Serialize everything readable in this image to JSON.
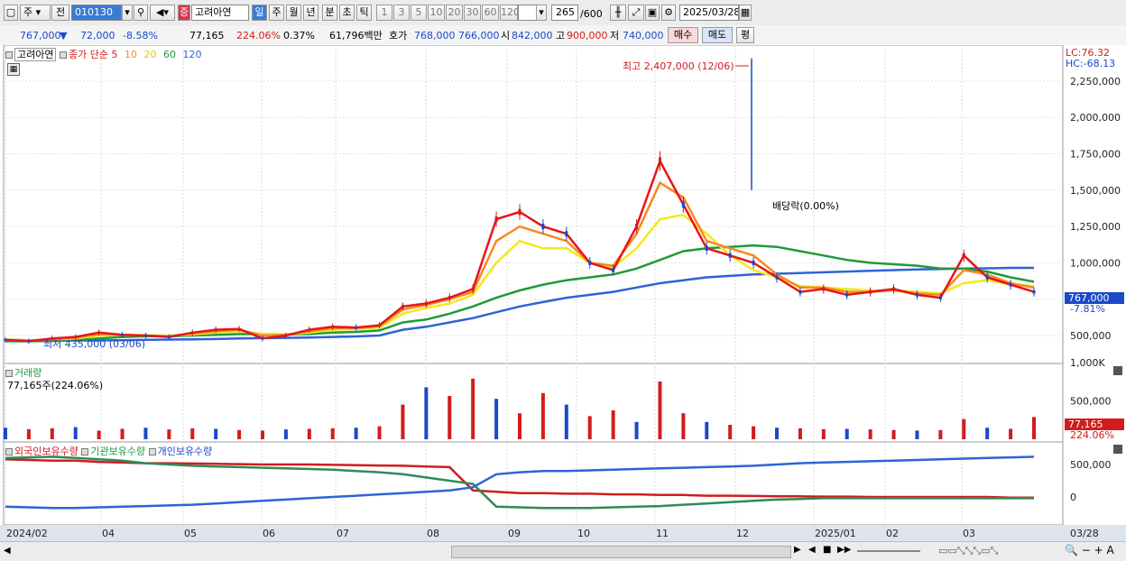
{
  "toolbar": {
    "market_label": "주",
    "prev_label": "전",
    "code": "010130",
    "stock_badge": "증",
    "stock_name": "고려아연",
    "period_tabs": [
      "일",
      "주",
      "월",
      "년",
      "분",
      "초",
      "틱"
    ],
    "active_period": "일",
    "intervals": [
      "1",
      "3",
      "5",
      "10",
      "20",
      "30",
      "60",
      "120"
    ],
    "count": "265",
    "count_total": "/600",
    "date": "2025/03/28"
  },
  "quote": {
    "price": "767,000",
    "change_arrow": "▼",
    "change": "72,000",
    "change_pct": "-8.58%",
    "volume": "77,165",
    "volume_ratio": "224.06%",
    "turnover": "0.37%",
    "amount": "61,796백만",
    "ask_label": "호가",
    "ask": "768,000",
    "bid": "766,000",
    "open_label": "시",
    "open": "842,000",
    "high_label": "고",
    "high": "900,000",
    "low_label": "저",
    "low": "740,000",
    "buy_label": "매수",
    "sell_label": "매도",
    "eval_label": "평"
  },
  "price_panel": {
    "legend_name": "고려아연",
    "ma_label": "종가 단순",
    "ma_periods": [
      "5",
      "10",
      "20",
      "60",
      "120"
    ],
    "ma_colors": [
      "#e8141b",
      "#f58a1f",
      "#f5e81b",
      "#1f9a3a",
      "#2e63d6"
    ],
    "lc": "LC:76.32",
    "hc": "HC:-68.13",
    "high_annotation": "최고 2,407,000 (12/06)",
    "low_annotation": "최저 435,000 (03/06)",
    "dividend_annotation": "배당락(0.00%)",
    "current_price_tag": "767,000",
    "current_pct_tag": "-7.81%"
  },
  "volume_panel": {
    "title": "거래량",
    "subtitle": "77,165주(224.06%)",
    "current_tag": "77,165",
    "current_pct_tag": "224.06%"
  },
  "holdings_panel": {
    "legend": [
      "외국인보유수량",
      "기관보유수량",
      "개인보유수량"
    ]
  },
  "x_axis": {
    "labels": [
      "2024/02",
      "04",
      "05",
      "06",
      "07",
      "08",
      "09",
      "10",
      "11",
      "12",
      "2025/01",
      "02",
      "03"
    ],
    "last_label": "03/28"
  },
  "chart_data": {
    "type": "line",
    "price_y_ticks": [
      "2,250,000",
      "2,000,000",
      "1,750,000",
      "1,500,000",
      "1,250,000",
      "1,000,000",
      "750,000",
      "500,000"
    ],
    "volume_y_ticks": [
      "1,000K",
      "500,000"
    ],
    "holdings_y_ticks": [
      "500,000",
      "0"
    ],
    "x_months": [
      "2024/02",
      "04",
      "05",
      "06",
      "07",
      "08",
      "09",
      "10",
      "11",
      "12",
      "2025/01",
      "02",
      "03"
    ],
    "ma5": [
      470,
      460,
      480,
      490,
      520,
      505,
      500,
      490,
      520,
      540,
      545,
      480,
      500,
      540,
      560,
      555,
      570,
      700,
      720,
      760,
      820,
      1300,
      1350,
      1250,
      1200,
      1000,
      950,
      1250,
      1700,
      1400,
      1100,
      1050,
      1000,
      900,
      800,
      820,
      780,
      800,
      820,
      780,
      760,
      1050,
      900,
      850,
      800
    ],
    "ma10": [
      470,
      465,
      475,
      485,
      510,
      505,
      500,
      495,
      515,
      530,
      540,
      500,
      505,
      530,
      550,
      550,
      565,
      680,
      710,
      750,
      800,
      1150,
      1250,
      1200,
      1150,
      1000,
      980,
      1200,
      1550,
      1450,
      1150,
      1100,
      1050,
      920,
      830,
      830,
      800,
      800,
      810,
      790,
      780,
      950,
      920,
      860,
      830
    ],
    "ma20": [
      470,
      468,
      472,
      480,
      500,
      505,
      502,
      498,
      508,
      520,
      530,
      510,
      508,
      520,
      540,
      545,
      555,
      650,
      690,
      720,
      780,
      1000,
      1150,
      1100,
      1100,
      1000,
      970,
      1100,
      1300,
      1330,
      1200,
      1050,
      950,
      900,
      840,
      830,
      820,
      810,
      810,
      800,
      790,
      860,
      880,
      850,
      840
    ],
    "ma60": [
      460,
      460,
      462,
      468,
      480,
      490,
      495,
      495,
      500,
      505,
      510,
      510,
      508,
      510,
      520,
      525,
      535,
      590,
      610,
      650,
      700,
      760,
      810,
      850,
      880,
      900,
      920,
      960,
      1020,
      1080,
      1100,
      1110,
      1120,
      1110,
      1080,
      1050,
      1020,
      1000,
      990,
      980,
      960,
      960,
      940,
      900,
      870
    ],
    "ma120": [
      470,
      468,
      466,
      465,
      466,
      468,
      470,
      472,
      474,
      476,
      480,
      482,
      484,
      486,
      490,
      494,
      500,
      540,
      560,
      590,
      620,
      660,
      700,
      730,
      760,
      780,
      800,
      830,
      860,
      880,
      900,
      910,
      920,
      925,
      930,
      935,
      940,
      945,
      950,
      955,
      958,
      960,
      962,
      965,
      965
    ],
    "volume": [
      40,
      35,
      38,
      42,
      30,
      36,
      40,
      34,
      38,
      36,
      32,
      30,
      34,
      36,
      38,
      40,
      45,
      120,
      180,
      150,
      210,
      140,
      90,
      160,
      120,
      80,
      100,
      60,
      200,
      90,
      60,
      50,
      45,
      40,
      38,
      35,
      36,
      34,
      32,
      30,
      32,
      70,
      40,
      36,
      77
    ],
    "foreign_holdings": [
      580,
      570,
      560,
      560,
      540,
      530,
      520,
      520,
      515,
      510,
      505,
      500,
      500,
      500,
      495,
      490,
      485,
      480,
      470,
      460,
      100,
      80,
      60,
      60,
      50,
      50,
      40,
      40,
      30,
      30,
      20,
      20,
      15,
      10,
      10,
      5,
      5,
      0,
      0,
      0,
      0,
      0,
      0,
      -10,
      -10
    ],
    "institution_holdings": [
      600,
      610,
      620,
      600,
      580,
      560,
      520,
      500,
      480,
      470,
      460,
      450,
      440,
      430,
      420,
      400,
      380,
      350,
      300,
      250,
      200,
      -150,
      -160,
      -170,
      -170,
      -170,
      -160,
      -150,
      -140,
      -120,
      -100,
      -80,
      -60,
      -40,
      -30,
      -20,
      -20,
      -20,
      -20,
      -20,
      -20,
      -20,
      -20,
      -20,
      -20
    ],
    "individual_holdings": [
      -150,
      -160,
      -170,
      -170,
      -160,
      -150,
      -140,
      -130,
      -120,
      -100,
      -80,
      -60,
      -40,
      -20,
      0,
      20,
      40,
      60,
      80,
      100,
      150,
      350,
      380,
      400,
      400,
      410,
      420,
      430,
      440,
      450,
      460,
      470,
      480,
      500,
      520,
      530,
      540,
      550,
      560,
      570,
      580,
      590,
      600,
      610,
      620
    ]
  }
}
